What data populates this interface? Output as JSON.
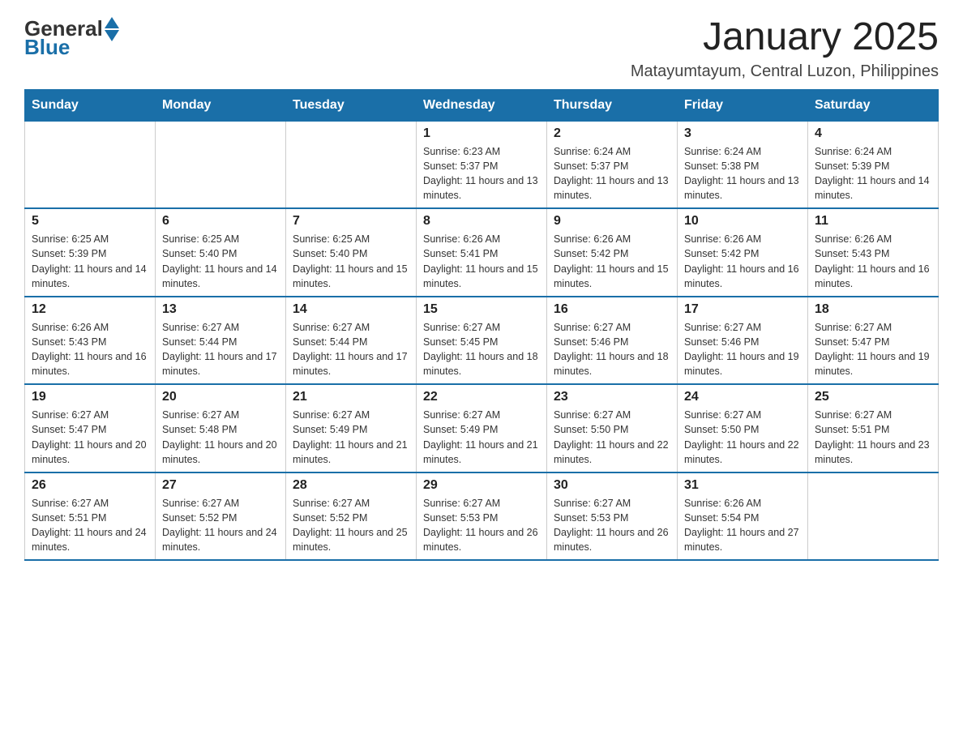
{
  "logo": {
    "general": "General",
    "blue": "Blue"
  },
  "title": "January 2025",
  "subtitle": "Matayumtayum, Central Luzon, Philippines",
  "header_days": [
    "Sunday",
    "Monday",
    "Tuesday",
    "Wednesday",
    "Thursday",
    "Friday",
    "Saturday"
  ],
  "weeks": [
    [
      {
        "day": "",
        "info": ""
      },
      {
        "day": "",
        "info": ""
      },
      {
        "day": "",
        "info": ""
      },
      {
        "day": "1",
        "info": "Sunrise: 6:23 AM\nSunset: 5:37 PM\nDaylight: 11 hours and 13 minutes."
      },
      {
        "day": "2",
        "info": "Sunrise: 6:24 AM\nSunset: 5:37 PM\nDaylight: 11 hours and 13 minutes."
      },
      {
        "day": "3",
        "info": "Sunrise: 6:24 AM\nSunset: 5:38 PM\nDaylight: 11 hours and 13 minutes."
      },
      {
        "day": "4",
        "info": "Sunrise: 6:24 AM\nSunset: 5:39 PM\nDaylight: 11 hours and 14 minutes."
      }
    ],
    [
      {
        "day": "5",
        "info": "Sunrise: 6:25 AM\nSunset: 5:39 PM\nDaylight: 11 hours and 14 minutes."
      },
      {
        "day": "6",
        "info": "Sunrise: 6:25 AM\nSunset: 5:40 PM\nDaylight: 11 hours and 14 minutes."
      },
      {
        "day": "7",
        "info": "Sunrise: 6:25 AM\nSunset: 5:40 PM\nDaylight: 11 hours and 15 minutes."
      },
      {
        "day": "8",
        "info": "Sunrise: 6:26 AM\nSunset: 5:41 PM\nDaylight: 11 hours and 15 minutes."
      },
      {
        "day": "9",
        "info": "Sunrise: 6:26 AM\nSunset: 5:42 PM\nDaylight: 11 hours and 15 minutes."
      },
      {
        "day": "10",
        "info": "Sunrise: 6:26 AM\nSunset: 5:42 PM\nDaylight: 11 hours and 16 minutes."
      },
      {
        "day": "11",
        "info": "Sunrise: 6:26 AM\nSunset: 5:43 PM\nDaylight: 11 hours and 16 minutes."
      }
    ],
    [
      {
        "day": "12",
        "info": "Sunrise: 6:26 AM\nSunset: 5:43 PM\nDaylight: 11 hours and 16 minutes."
      },
      {
        "day": "13",
        "info": "Sunrise: 6:27 AM\nSunset: 5:44 PM\nDaylight: 11 hours and 17 minutes."
      },
      {
        "day": "14",
        "info": "Sunrise: 6:27 AM\nSunset: 5:44 PM\nDaylight: 11 hours and 17 minutes."
      },
      {
        "day": "15",
        "info": "Sunrise: 6:27 AM\nSunset: 5:45 PM\nDaylight: 11 hours and 18 minutes."
      },
      {
        "day": "16",
        "info": "Sunrise: 6:27 AM\nSunset: 5:46 PM\nDaylight: 11 hours and 18 minutes."
      },
      {
        "day": "17",
        "info": "Sunrise: 6:27 AM\nSunset: 5:46 PM\nDaylight: 11 hours and 19 minutes."
      },
      {
        "day": "18",
        "info": "Sunrise: 6:27 AM\nSunset: 5:47 PM\nDaylight: 11 hours and 19 minutes."
      }
    ],
    [
      {
        "day": "19",
        "info": "Sunrise: 6:27 AM\nSunset: 5:47 PM\nDaylight: 11 hours and 20 minutes."
      },
      {
        "day": "20",
        "info": "Sunrise: 6:27 AM\nSunset: 5:48 PM\nDaylight: 11 hours and 20 minutes."
      },
      {
        "day": "21",
        "info": "Sunrise: 6:27 AM\nSunset: 5:49 PM\nDaylight: 11 hours and 21 minutes."
      },
      {
        "day": "22",
        "info": "Sunrise: 6:27 AM\nSunset: 5:49 PM\nDaylight: 11 hours and 21 minutes."
      },
      {
        "day": "23",
        "info": "Sunrise: 6:27 AM\nSunset: 5:50 PM\nDaylight: 11 hours and 22 minutes."
      },
      {
        "day": "24",
        "info": "Sunrise: 6:27 AM\nSunset: 5:50 PM\nDaylight: 11 hours and 22 minutes."
      },
      {
        "day": "25",
        "info": "Sunrise: 6:27 AM\nSunset: 5:51 PM\nDaylight: 11 hours and 23 minutes."
      }
    ],
    [
      {
        "day": "26",
        "info": "Sunrise: 6:27 AM\nSunset: 5:51 PM\nDaylight: 11 hours and 24 minutes."
      },
      {
        "day": "27",
        "info": "Sunrise: 6:27 AM\nSunset: 5:52 PM\nDaylight: 11 hours and 24 minutes."
      },
      {
        "day": "28",
        "info": "Sunrise: 6:27 AM\nSunset: 5:52 PM\nDaylight: 11 hours and 25 minutes."
      },
      {
        "day": "29",
        "info": "Sunrise: 6:27 AM\nSunset: 5:53 PM\nDaylight: 11 hours and 26 minutes."
      },
      {
        "day": "30",
        "info": "Sunrise: 6:27 AM\nSunset: 5:53 PM\nDaylight: 11 hours and 26 minutes."
      },
      {
        "day": "31",
        "info": "Sunrise: 6:26 AM\nSunset: 5:54 PM\nDaylight: 11 hours and 27 minutes."
      },
      {
        "day": "",
        "info": ""
      }
    ]
  ]
}
